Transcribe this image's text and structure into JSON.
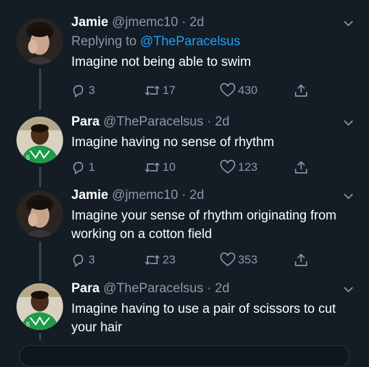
{
  "colors": {
    "background": "#141d26",
    "text_primary": "#ffffff",
    "text_secondary": "#8899a6",
    "accent": "#1da1f2",
    "thread_line": "#38444d"
  },
  "tweets": [
    {
      "name": "Jamie",
      "handle": "@jmemc10",
      "dot": "·",
      "time": "2d",
      "replying_prefix": "Replying to",
      "replying_to": "@TheParacelsus",
      "text": "Imagine not being able to swim",
      "replies": "3",
      "retweets": "17",
      "likes": "430",
      "avatar_icon": "avatar-jamie"
    },
    {
      "name": "Para",
      "handle": "@TheParacelsus",
      "dot": "·",
      "time": "2d",
      "text": "Imagine having no sense of rhythm",
      "replies": "1",
      "retweets": "10",
      "likes": "123",
      "avatar_icon": "avatar-para"
    },
    {
      "name": "Jamie",
      "handle": "@jmemc10",
      "dot": "·",
      "time": "2d",
      "text": "Imagine your sense of rhythm originating from working on a cotton field",
      "replies": "3",
      "retweets": "23",
      "likes": "353",
      "avatar_icon": "avatar-jamie"
    },
    {
      "name": "Para",
      "handle": "@TheParacelsus",
      "dot": "·",
      "time": "2d",
      "text": "Imagine having to use a pair of scissors to cut your hair",
      "avatar_icon": "avatar-para"
    }
  ],
  "icons": {
    "reply": "reply-icon",
    "retweet": "retweet-icon",
    "like": "heart-icon",
    "share": "share-icon",
    "menu": "chevron-down-icon"
  }
}
